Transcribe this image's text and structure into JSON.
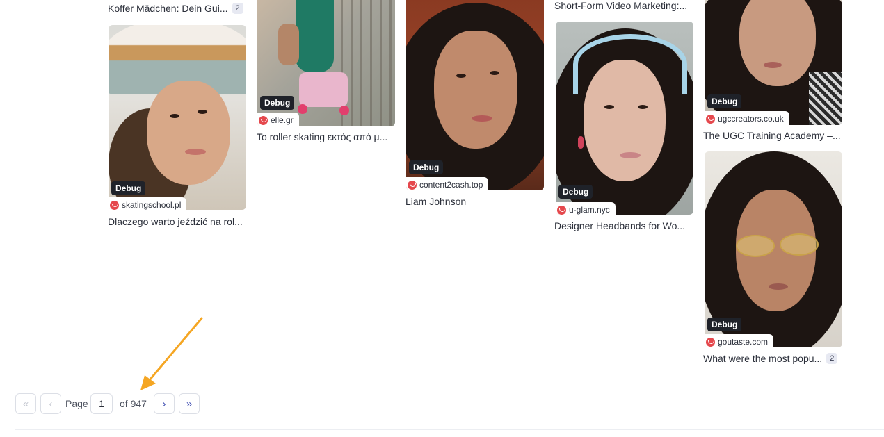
{
  "cards": [
    {
      "title": "Koffer Mädchen: Dein Gui...",
      "count": "2"
    },
    {
      "badge": "Debug",
      "source": "skatingschool.pl",
      "title": "Dlaczego warto jeździć na rol..."
    },
    {
      "badge": "Debug",
      "source": "elle.gr",
      "title": "To roller skating εκτός από μ..."
    },
    {
      "badge": "Debug",
      "source": "content2cash.top",
      "title": "Liam Johnson"
    },
    {
      "title": "Short-Form Video Marketing:..."
    },
    {
      "badge": "Debug",
      "source": "u-glam.nyc",
      "title": "Designer Headbands for Wo..."
    },
    {
      "badge": "Debug",
      "source": "ugccreators.co.uk",
      "title": "The UGC Training Academy –..."
    },
    {
      "badge": "Debug",
      "source": "goutaste.com",
      "title": "What were the most popu...",
      "count": "2"
    }
  ],
  "pagination": {
    "first_icon": "double-chevron-left-icon",
    "prev_icon": "chevron-left-icon",
    "next_icon": "chevron-right-icon",
    "last_icon": "double-chevron-right-icon",
    "page_label": "Page",
    "current_page": "1",
    "total_label": "of 947"
  },
  "annotation": {
    "arrow_color": "#f5a623"
  }
}
